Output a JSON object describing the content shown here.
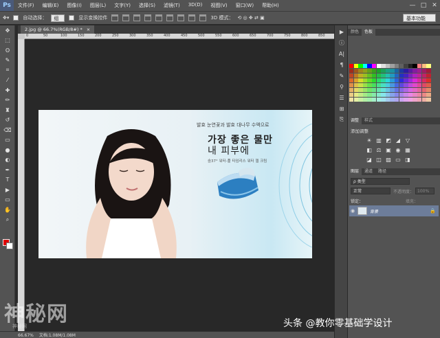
{
  "app": {
    "logo": "Ps"
  },
  "menu": [
    "文件(F)",
    "编辑(E)",
    "图像(I)",
    "图层(L)",
    "文字(Y)",
    "选择(S)",
    "滤镜(T)",
    "3D(D)",
    "视图(V)",
    "窗口(W)",
    "帮助(H)"
  ],
  "window_controls": {
    "minimize": "—",
    "maximize": "□",
    "close": "✕"
  },
  "options": {
    "auto_select_label": "自动选择：",
    "auto_select_value": "组",
    "show_transform_label": "显示变换控件",
    "mode_3d_label": "3D 模式：",
    "workspace": "基本功能"
  },
  "document_tab": {
    "title": "2.jpg @ 66.7%(RGB/8#) *",
    "close": "×"
  },
  "ruler_ticks": [
    "0",
    "50",
    "100",
    "150",
    "200",
    "250",
    "300",
    "350",
    "400",
    "450",
    "500",
    "550",
    "600",
    "650",
    "700",
    "750",
    "800",
    "850"
  ],
  "tools": [
    "move-tool",
    "marquee-tool",
    "lasso-tool",
    "quick-select-tool",
    "crop-tool",
    "eyedropper-tool",
    "healing-tool",
    "brush-tool",
    "stamp-tool",
    "history-brush-tool",
    "eraser-tool",
    "gradient-tool",
    "blur-tool",
    "dodge-tool",
    "pen-tool",
    "type-tool",
    "path-select-tool",
    "shape-tool",
    "hand-tool",
    "zoom-tool"
  ],
  "tool_glyphs": [
    "✥",
    "⬚",
    "ʘ",
    "✎",
    "⌗",
    "⁄",
    "✚",
    "✏",
    "♜",
    "↺",
    "⌫",
    "▭",
    "●",
    "◐",
    "✒",
    "T",
    "▶",
    "▭",
    "✋",
    "⌕"
  ],
  "colors": {
    "foreground": "#e00000",
    "background": "#ffffff"
  },
  "canvas": {
    "line1": "발효 눈연꽃과 발효 대나무 수액으로",
    "line2": "가장 좋은 물만",
    "line3": "내 피부에",
    "line4": "숨37° 워터-풀 타임리스 워터 젤 크림"
  },
  "status": {
    "zoom": "66.67%",
    "doc_info": "文档:1.08M/1.08M"
  },
  "right_strip": [
    "play-icon",
    "info-icon",
    "char-icon",
    "para-icon",
    "brush-preset-icon",
    "clone-source-icon",
    "layer-comp-icon",
    "measure-icon",
    "history-icon"
  ],
  "right_strip_glyphs": [
    "▶",
    "ⓘ",
    "A|",
    "¶",
    "✎",
    "⚲",
    "☰",
    "⊞",
    "⎘"
  ],
  "panels": {
    "swatch_tabs": [
      "颜色",
      "色板"
    ],
    "adjust_tabs": [
      "调整",
      "样式"
    ],
    "adjust_title": "添加调整",
    "layer_tabs": [
      "图层",
      "通道",
      "路径"
    ],
    "layer_filter": "ρ 类型",
    "blend_mode": "正常",
    "opacity_label": "不透明度：",
    "opacity_value": "100%",
    "lock_label": "锁定：",
    "fill_label": "填充：",
    "layer_name": "背景",
    "layer_eye": "◉",
    "layer_lock": "🔒"
  },
  "watermark": {
    "left": "神秘网",
    "left_sub": "神秘网",
    "right": "头条 @教你零基础学设计"
  }
}
